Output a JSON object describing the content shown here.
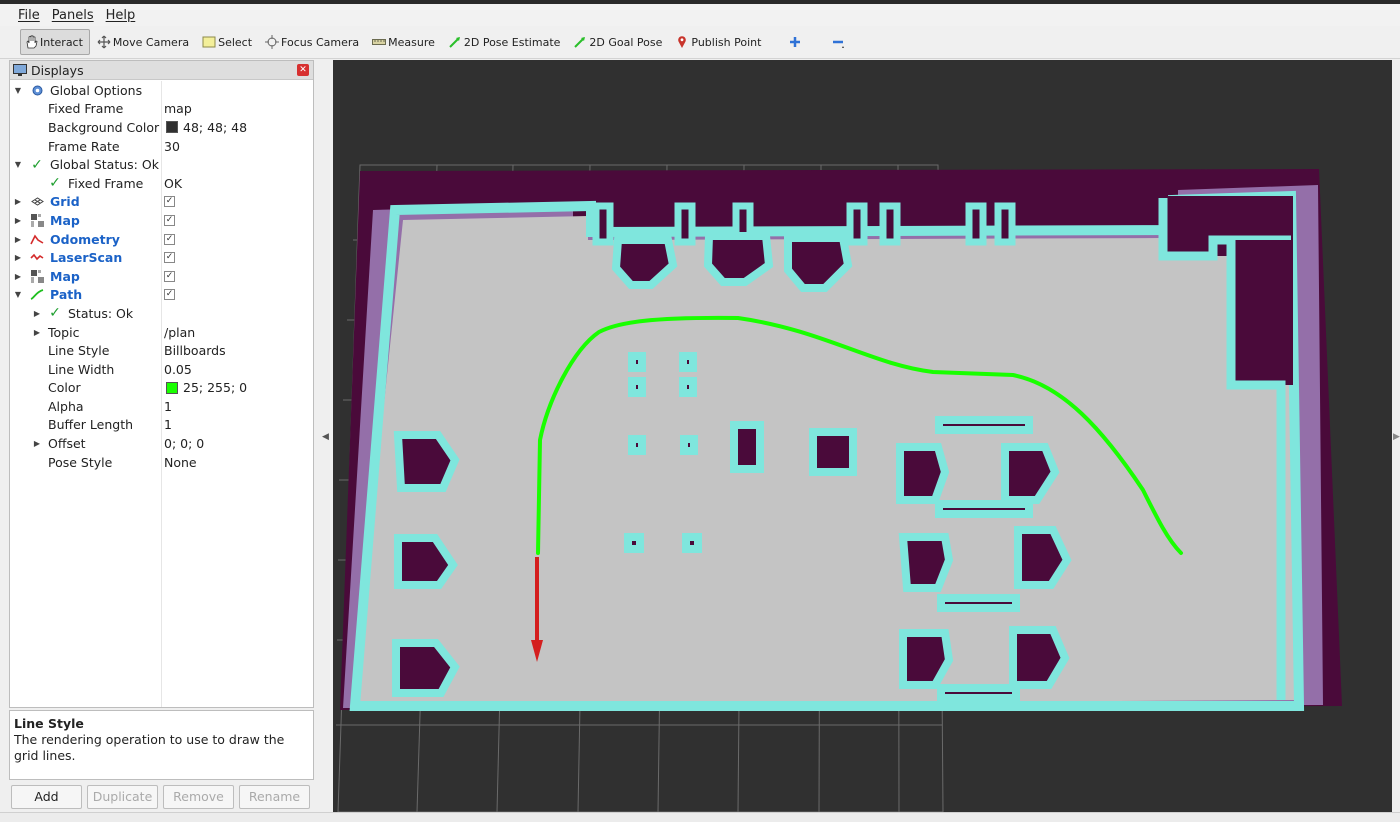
{
  "menu": [
    "File",
    "Panels",
    "Help"
  ],
  "toolbar": {
    "interact": "Interact",
    "move_camera": "Move Camera",
    "select": "Select",
    "focus_camera": "Focus Camera",
    "measure": "Measure",
    "pose_estimate": "2D Pose Estimate",
    "goal_pose": "2D Goal Pose",
    "publish_point": "Publish Point"
  },
  "displays": {
    "title": "Displays",
    "rows": [
      {
        "label": "Global Options"
      },
      {
        "label": "Fixed Frame",
        "value": "map"
      },
      {
        "label": "Background Color",
        "value": "48; 48; 48"
      },
      {
        "label": "Frame Rate",
        "value": "30"
      },
      {
        "label": "Global Status: Ok"
      },
      {
        "label": "Fixed Frame",
        "value": "OK"
      },
      {
        "label": "Grid"
      },
      {
        "label": "Map"
      },
      {
        "label": "Odometry"
      },
      {
        "label": "LaserScan"
      },
      {
        "label": "Map"
      },
      {
        "label": "Path"
      },
      {
        "label": "Status: Ok"
      },
      {
        "label": "Topic",
        "value": "/plan"
      },
      {
        "label": "Line Style",
        "value": "Billboards"
      },
      {
        "label": "Line Width",
        "value": "0.05"
      },
      {
        "label": "Color",
        "value": "25; 255; 0"
      },
      {
        "label": "Alpha",
        "value": "1"
      },
      {
        "label": "Buffer Length",
        "value": "1"
      },
      {
        "label": "Offset",
        "value": "0; 0; 0"
      },
      {
        "label": "Pose Style",
        "value": "None"
      }
    ]
  },
  "colors": {
    "background": "#303030",
    "path": "#19ff00",
    "map_occupied": "#4a0a3a",
    "map_inflated": "#7fe6dd",
    "map_free": "#c0c0c0"
  },
  "help": {
    "title": "Line Style",
    "description": "The rendering operation to use to draw the grid lines."
  },
  "buttons": {
    "add": "Add",
    "duplicate": "Duplicate",
    "remove": "Remove",
    "rename": "Rename"
  }
}
